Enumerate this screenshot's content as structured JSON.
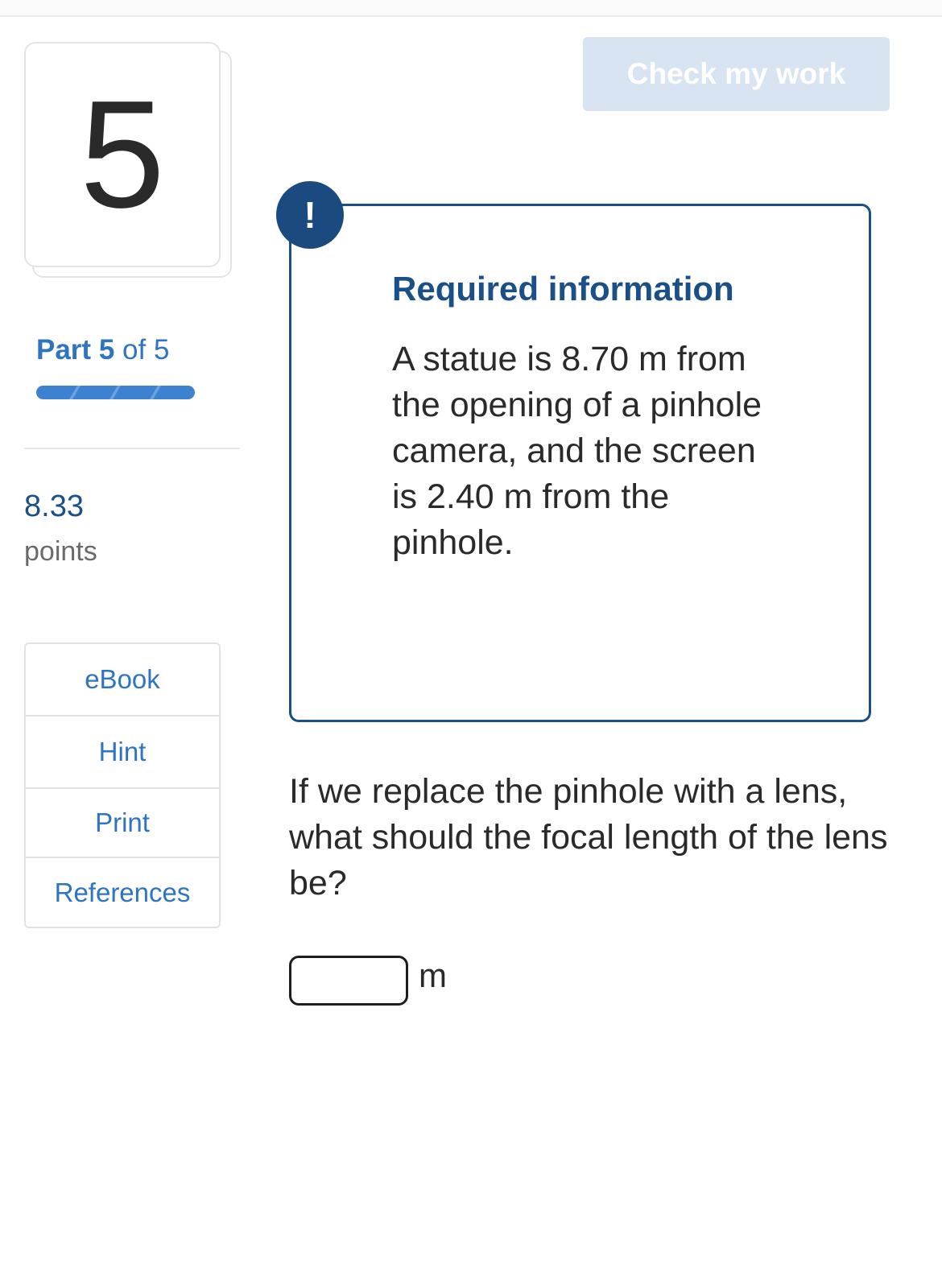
{
  "question": {
    "number": "5",
    "part_label": "Part",
    "part_current": "5",
    "part_of": "of 5",
    "progress_fraction": 1.0,
    "points_value": "8.33",
    "points_label": "points"
  },
  "toolbar": {
    "check_label": "Check my work"
  },
  "sidebar": {
    "tools": [
      {
        "label": "eBook"
      },
      {
        "label": "Hint"
      },
      {
        "label": "Print"
      },
      {
        "label": "References"
      }
    ]
  },
  "info": {
    "badge": "!",
    "title": "Required information",
    "body": "A statue is 8.70 m from the opening of a pinhole camera, and the screen is 2.40 m from the pinhole."
  },
  "prompt": {
    "text": "If we replace the pinhole with a lens, what should the focal length of the lens be?",
    "answer_value": "",
    "unit": "m"
  },
  "colors": {
    "accent": "#2f74c0",
    "brand_dark": "#1b4f88",
    "button_disabled": "#d9e4f2"
  }
}
